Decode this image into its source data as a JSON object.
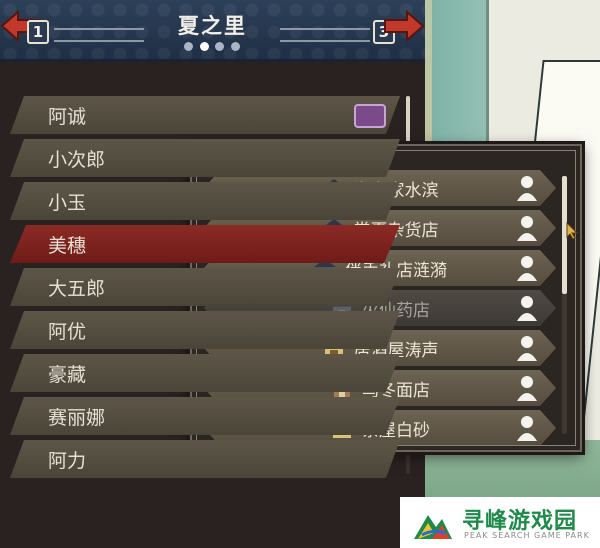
{
  "header": {
    "title": "夏之里",
    "prev_key": "1",
    "next_key": "3",
    "page_count": 4,
    "active_page": 1
  },
  "characters": [
    {
      "name": "阿诚",
      "selected": false,
      "has_badge": true
    },
    {
      "name": "小次郎",
      "selected": false
    },
    {
      "name": "小玉",
      "selected": false
    },
    {
      "name": "美穗",
      "selected": true
    },
    {
      "name": "大五郎",
      "selected": false
    },
    {
      "name": "阿优",
      "selected": false
    },
    {
      "name": "豪藏",
      "selected": false
    },
    {
      "name": "赛丽娜",
      "selected": false
    },
    {
      "name": "阿力",
      "selected": false
    }
  ],
  "shops": [
    {
      "name": "海之家水滨",
      "icon": "house-icon",
      "dim": false
    },
    {
      "name": "常夏杂货店",
      "icon": "house-icon",
      "dim": false
    },
    {
      "name": "伴手礼店涟漪",
      "icon": "house-icon",
      "dim": false
    },
    {
      "name": "火仙药店",
      "icon": "house-icon",
      "dim": true
    },
    {
      "name": "居酒屋涛声",
      "icon": "tavern-icon",
      "dim": false
    },
    {
      "name": "乌冬面店",
      "icon": "noodle-shop-icon",
      "dim": false
    },
    {
      "name": "茶屋白砂",
      "icon": "teahouse-icon",
      "dim": false
    }
  ],
  "watermark": {
    "title": "寻峰游戏园",
    "subtitle": "PEAK SEARCH GAME PARK"
  },
  "colors": {
    "header_bg": "#1f2f45",
    "selected_row": "#8c2a25",
    "row_bg": "#5d5648",
    "panel_bg": "#2a2220",
    "watermark_green": "#1f8a4a"
  }
}
